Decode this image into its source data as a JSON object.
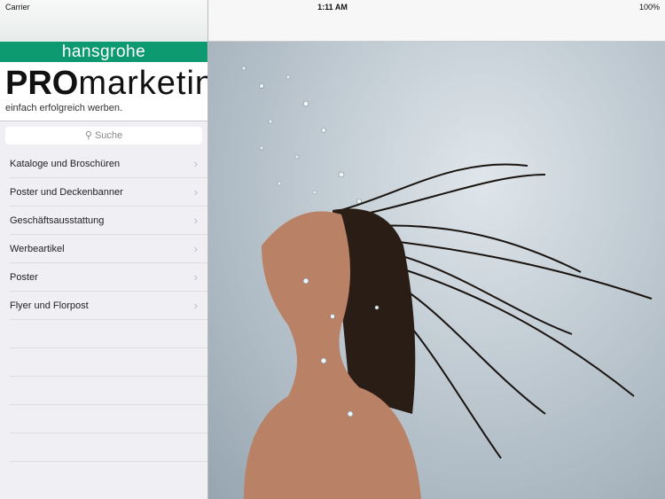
{
  "status": {
    "carrier": "Carrier",
    "time": "1:11 AM",
    "battery": "100%"
  },
  "brand": {
    "name": "hansgrohe",
    "pro": "PRO",
    "marketing": "marketing",
    "tagline": "einfach erfolgreich werben."
  },
  "search": {
    "placeholder": "Suche"
  },
  "menu": [
    {
      "label": "Kataloge und Broschüren"
    },
    {
      "label": "Poster und Deckenbanner"
    },
    {
      "label": "Geschäftsausstattung"
    },
    {
      "label": "Werbeartikel"
    },
    {
      "label": "Poster"
    },
    {
      "label": "Flyer und Florpost"
    }
  ],
  "colors": {
    "brand_green": "#0e9a70"
  }
}
